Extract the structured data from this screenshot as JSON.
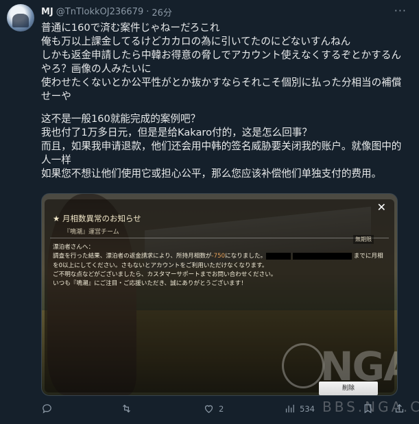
{
  "author": {
    "name": "MJ",
    "handle": "@TnTlokkOJ236679",
    "separator": "·",
    "time": "26分"
  },
  "tweet": {
    "paragraph_jp": "普通に160で済む案件じゃねーだろこれ\n俺も万以上課金してるけどカカロの為に引いてたのにどないすんねん\nしかも返金申請したら中韓お得意の脅しでアカウント使えなくするぞとかするんやろ？画像の人みたいに\n使わせたくないとか公平性がとか抜かすならそれこそ個別に払った分相当の補償せーや",
    "paragraph_cn": "这不是一般160就能完成的案例吧？\n我也付了1万多日元，但是是给Kakaro付的，这是怎么回事？\n而且，如果我申请退款，他们还会用中韩的签名威胁要关闭我的账户。就像图中的人一样\n如果您不想让他们使用它或担心公平，那么您应该补偿他们单独支付的费用。"
  },
  "media": {
    "dialog_title": "★ 月相数異常のお知らせ",
    "team": "『鳴潮』運営チーム",
    "badge": "無期限",
    "body_greeting": "漂泊者さんへ：",
    "body_line1_a": "調査を行った結果、漂泊者の返金請求により、所持月相数が",
    "body_line1_hl": "-750",
    "body_line1_b": "になりました。",
    "body_line1_c": "までに月相",
    "body_line2": "を0以上にしてください。さもないとアカウントをご利用いただけなくなります。",
    "body_line3": "ご不明な点などがございましたら、カスタマーサポートまでお問い合わせください。",
    "body_line4": "いつも『鳴潮』にご注目・ご応援いただき、誠にありがとうございます！",
    "delete_label": "削除",
    "close_icon": "✕",
    "watermark_text": "NGA",
    "watermark_url": "BBS.NGA.CN"
  },
  "actions": {
    "reply_count": "",
    "retweet_count": "",
    "like_count": "2",
    "views_count": "534"
  },
  "colors": {
    "background": "#15202b",
    "text": "#e7e9ea",
    "muted": "#8b98a5",
    "highlight": "#e8a25a"
  }
}
